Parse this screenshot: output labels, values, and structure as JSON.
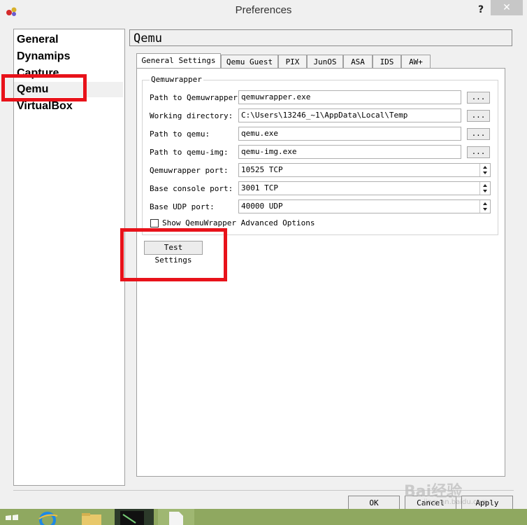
{
  "window": {
    "title": "Preferences",
    "help_label": "?",
    "close_label": "✕"
  },
  "sidebar": {
    "items": [
      {
        "label": "General"
      },
      {
        "label": "Dynamips"
      },
      {
        "label": "Capture"
      },
      {
        "label": "Qemu",
        "selected": true
      },
      {
        "label": "VirtualBox"
      }
    ]
  },
  "panel": {
    "title": "Qemu"
  },
  "tabs": [
    {
      "label": "General Settings",
      "active": true
    },
    {
      "label": "Qemu Guest"
    },
    {
      "label": "PIX"
    },
    {
      "label": "JunOS"
    },
    {
      "label": "ASA"
    },
    {
      "label": "IDS"
    },
    {
      "label": "AW+"
    }
  ],
  "group": {
    "title": "Qemuwrapper",
    "rows": [
      {
        "label": "Path to Qemuwrapper:",
        "value": "qemuwrapper.exe",
        "control": "browse"
      },
      {
        "label": "Working directory:",
        "value": "C:\\Users\\13246_~1\\AppData\\Local\\Temp",
        "control": "browse"
      },
      {
        "label": "Path to qemu:",
        "value": "qemu.exe",
        "control": "browse"
      },
      {
        "label": "Path to qemu-img:",
        "value": "qemu-img.exe",
        "control": "browse"
      },
      {
        "label": "Qemuwrapper port:",
        "value": "10525 TCP",
        "control": "spin"
      },
      {
        "label": "Base console port:",
        "value": "3001 TCP",
        "control": "spin"
      },
      {
        "label": "Base UDP port:",
        "value": "40000 UDP",
        "control": "spin"
      }
    ],
    "browse_label": "...",
    "advanced_checkbox": {
      "label": "Show QemuWrapper Advanced Options",
      "checked": false
    }
  },
  "test_button": {
    "label": "Test Settings"
  },
  "dialog_buttons": {
    "ok": "OK",
    "cancel": "Cancel",
    "apply": "Apply"
  },
  "watermark": {
    "brand": "Bai经验",
    "url": "jingyan.baidu.com"
  },
  "colors": {
    "highlight": "#e8121a",
    "taskbar": "#8fa860"
  }
}
